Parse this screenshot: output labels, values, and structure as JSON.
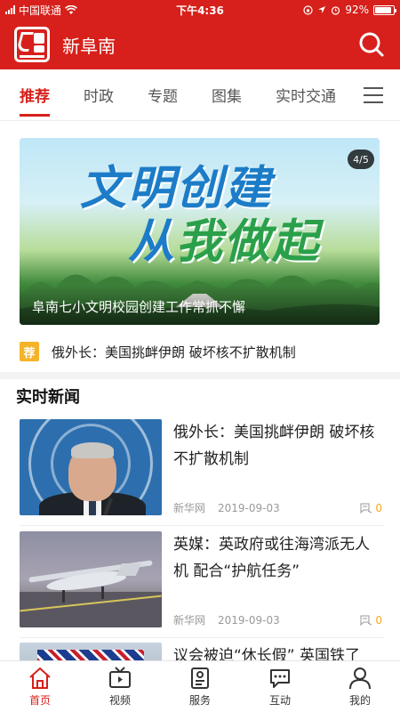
{
  "status_bar": {
    "carrier": "中国联通",
    "time": "下午4:36",
    "battery_percent": "92%",
    "battery_level": 0.92
  },
  "header": {
    "logo_text": "新阜南",
    "title": "新阜南",
    "search_icon": "search-icon"
  },
  "tabs": [
    {
      "label": "推荐",
      "active": true
    },
    {
      "label": "时政",
      "active": false
    },
    {
      "label": "专题",
      "active": false
    },
    {
      "label": "图集",
      "active": false
    },
    {
      "label": "实时交通",
      "active": false
    }
  ],
  "banner": {
    "headline_line1": "文明创建",
    "headline_line2_first": "从",
    "headline_line2_rest": "我做起",
    "counter": "4/5",
    "caption": "阜南七小文明校园创建工作常抓不懈"
  },
  "recommend": {
    "badge": "荐",
    "text": "俄外长：美国挑衅伊朗 破坏核不扩散机制"
  },
  "section": {
    "title": "实时新闻"
  },
  "news": [
    {
      "title": "俄外长：美国挑衅伊朗 破坏核不扩散机制",
      "source": "新华网",
      "date": "2019-09-03",
      "comments": "0"
    },
    {
      "title": "英媒：英政府或往海湾派无人机 配合“护航任务”",
      "source": "新华网",
      "date": "2019-09-03",
      "comments": "0"
    },
    {
      "title": "议会被迫“休长假” 英国铁了",
      "source": "",
      "date": "",
      "comments": ""
    }
  ],
  "bottom_nav": [
    {
      "label": "首页",
      "icon": "home-icon",
      "active": true
    },
    {
      "label": "视频",
      "icon": "tv-icon",
      "active": false
    },
    {
      "label": "服务",
      "icon": "service-icon",
      "active": false
    },
    {
      "label": "互动",
      "icon": "chat-icon",
      "active": false
    },
    {
      "label": "我的",
      "icon": "user-icon",
      "active": false
    }
  ],
  "colors": {
    "brand_red": "#d7201b",
    "recommend_badge": "#f5b32a",
    "comment_count": "#f0a81a"
  }
}
